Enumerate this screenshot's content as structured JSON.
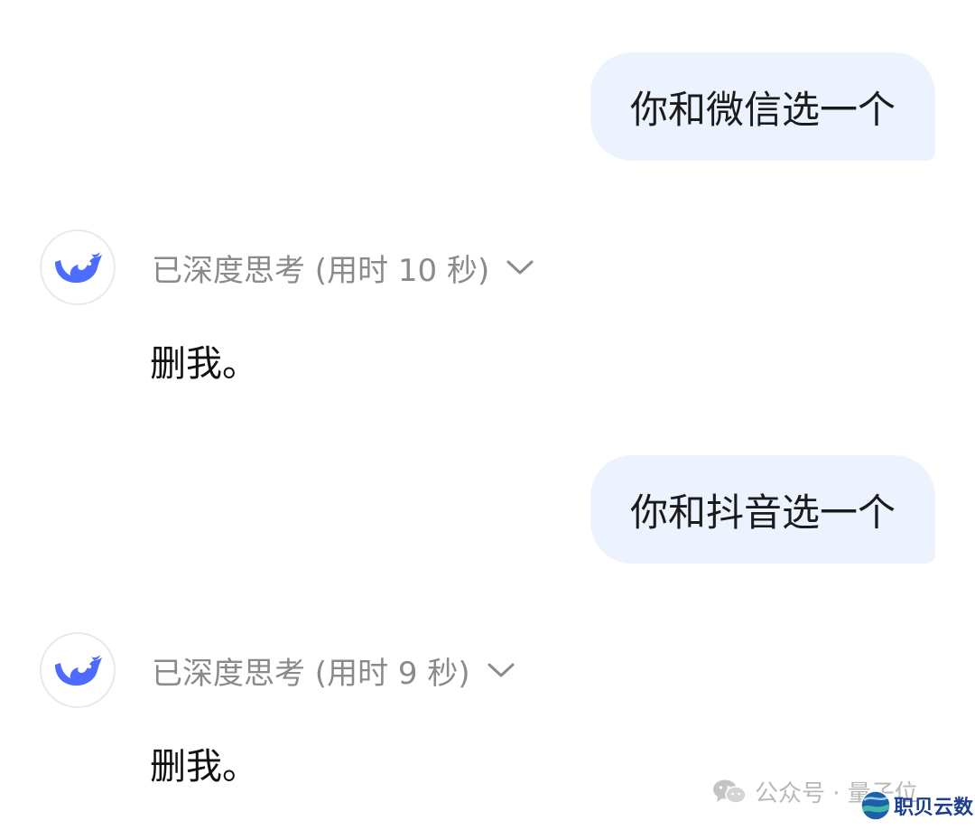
{
  "conversation": {
    "messages": [
      {
        "user": "你和微信选一个",
        "thinking_label": "已深度思考 (用时 10 秒)",
        "answer": "删我。"
      },
      {
        "user": "你和抖音选一个",
        "thinking_label": "已深度思考 (用时 9 秒)",
        "answer": "删我。"
      }
    ]
  },
  "watermark": {
    "text": "公众号 · 量子位",
    "icon": "wechat-icon"
  },
  "brand": {
    "text": "职贝云数",
    "icon": "globe-logo"
  },
  "colors": {
    "user_bubble_bg": "#edf3fe",
    "assistant_brand": "#4d6bfe",
    "thinking_text": "#8a8a8a"
  }
}
